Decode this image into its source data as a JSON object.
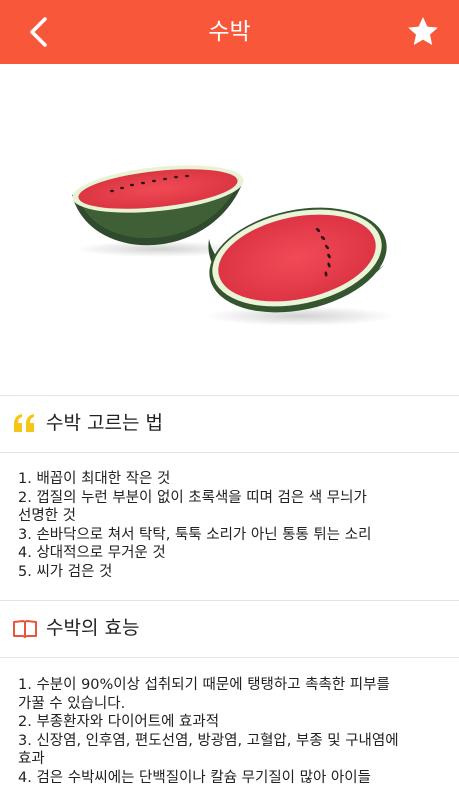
{
  "header": {
    "title": "수박",
    "back_icon": "chevron-left-icon",
    "favorite_icon": "star-icon"
  },
  "colors": {
    "header_bg": "#f9573a",
    "quote_icon": "#f5c518",
    "book_icon": "#e8553a"
  },
  "sections": [
    {
      "icon": "quote-icon",
      "title": "수박 고르는 법",
      "lines": [
        "1. 배꼽이 최대한 작은 것",
        "2. 껍질의 누런 부분이 없이 초록색을 띠며 검은 색 무늬가",
        "선명한 것",
        "3. 손바닥으로 쳐서 탁탁, 툭툭 소리가 아닌 통통 튀는 소리",
        "4. 상대적으로 무거운 것",
        "5. 씨가 검은 것"
      ]
    },
    {
      "icon": "book-icon",
      "title": "수박의 효능",
      "lines": [
        "1. 수분이 90%이상 섭취되기 때문에 탱탱하고 촉촉한 피부를",
        "가꿀 수 있습니다.",
        "2. 부종환자와 다이어트에 효과적",
        "3. 신장염, 인후염, 편도선염, 방광염, 고혈압, 부종 및 구내염에",
        "효과",
        "4. 검은 수박씨에는 단백질이나 칼슘 무기질이 많아 아이들"
      ]
    }
  ]
}
